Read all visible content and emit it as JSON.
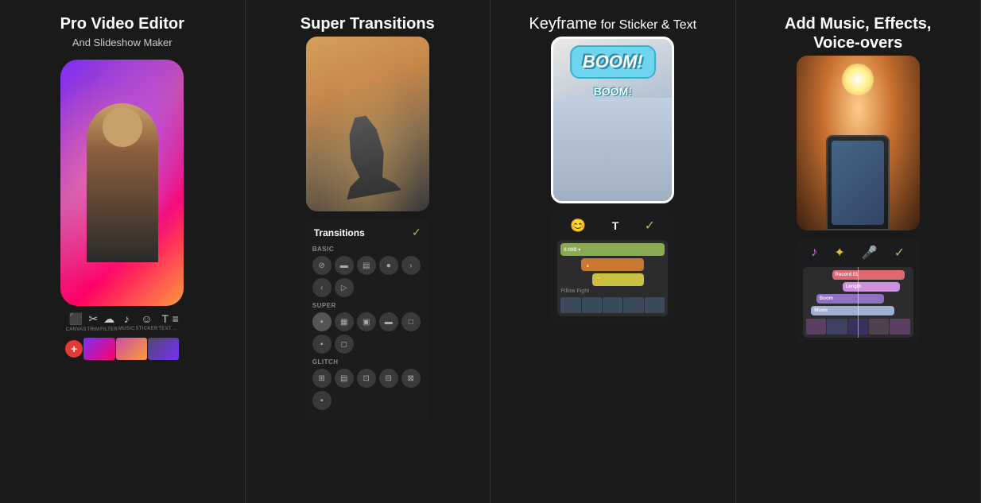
{
  "panels": [
    {
      "id": "panel-1",
      "title": "Pro Video Editor",
      "subtitle": "And Slideshow Maker",
      "toolbar": {
        "items": [
          {
            "icon": "⬛",
            "label": "CANVAS"
          },
          {
            "icon": "✂",
            "label": "TRIM"
          },
          {
            "icon": "☁",
            "label": "FILTER"
          },
          {
            "icon": "♪",
            "label": "MUSIC"
          },
          {
            "icon": "☺",
            "label": "STICKER"
          },
          {
            "icon": "T",
            "label": "TEXT"
          },
          {
            "icon": "≡",
            "label": "..."
          }
        ]
      }
    },
    {
      "id": "panel-2",
      "title": "Super Transitions",
      "sections": [
        {
          "label": "BASIC",
          "count": 7
        },
        {
          "label": "SUPER",
          "count": 7
        },
        {
          "label": "GLITCH",
          "count": 6
        }
      ],
      "check_label": "✓",
      "transitions_label": "Transitions"
    },
    {
      "id": "panel-3",
      "title": "Keyframe",
      "title_suffix": " for Sticker & Text",
      "boom_text": "BOOM!",
      "boom_text2": "BOOM!",
      "tracks": [
        {
          "label": "6:00B",
          "color": "green"
        },
        {
          "label": "",
          "color": "orange"
        },
        {
          "label": "",
          "color": "yellow"
        },
        {
          "label": "Pillow Fight",
          "color": "label"
        }
      ]
    },
    {
      "id": "panel-4",
      "title": "Add Music, Effects, Voice-overs",
      "tracks": [
        {
          "label": "Record 01",
          "color": "record"
        },
        {
          "label": "Length",
          "color": "length"
        },
        {
          "label": "Boom",
          "color": "boom"
        },
        {
          "label": "Music",
          "color": "music"
        }
      ]
    }
  ]
}
